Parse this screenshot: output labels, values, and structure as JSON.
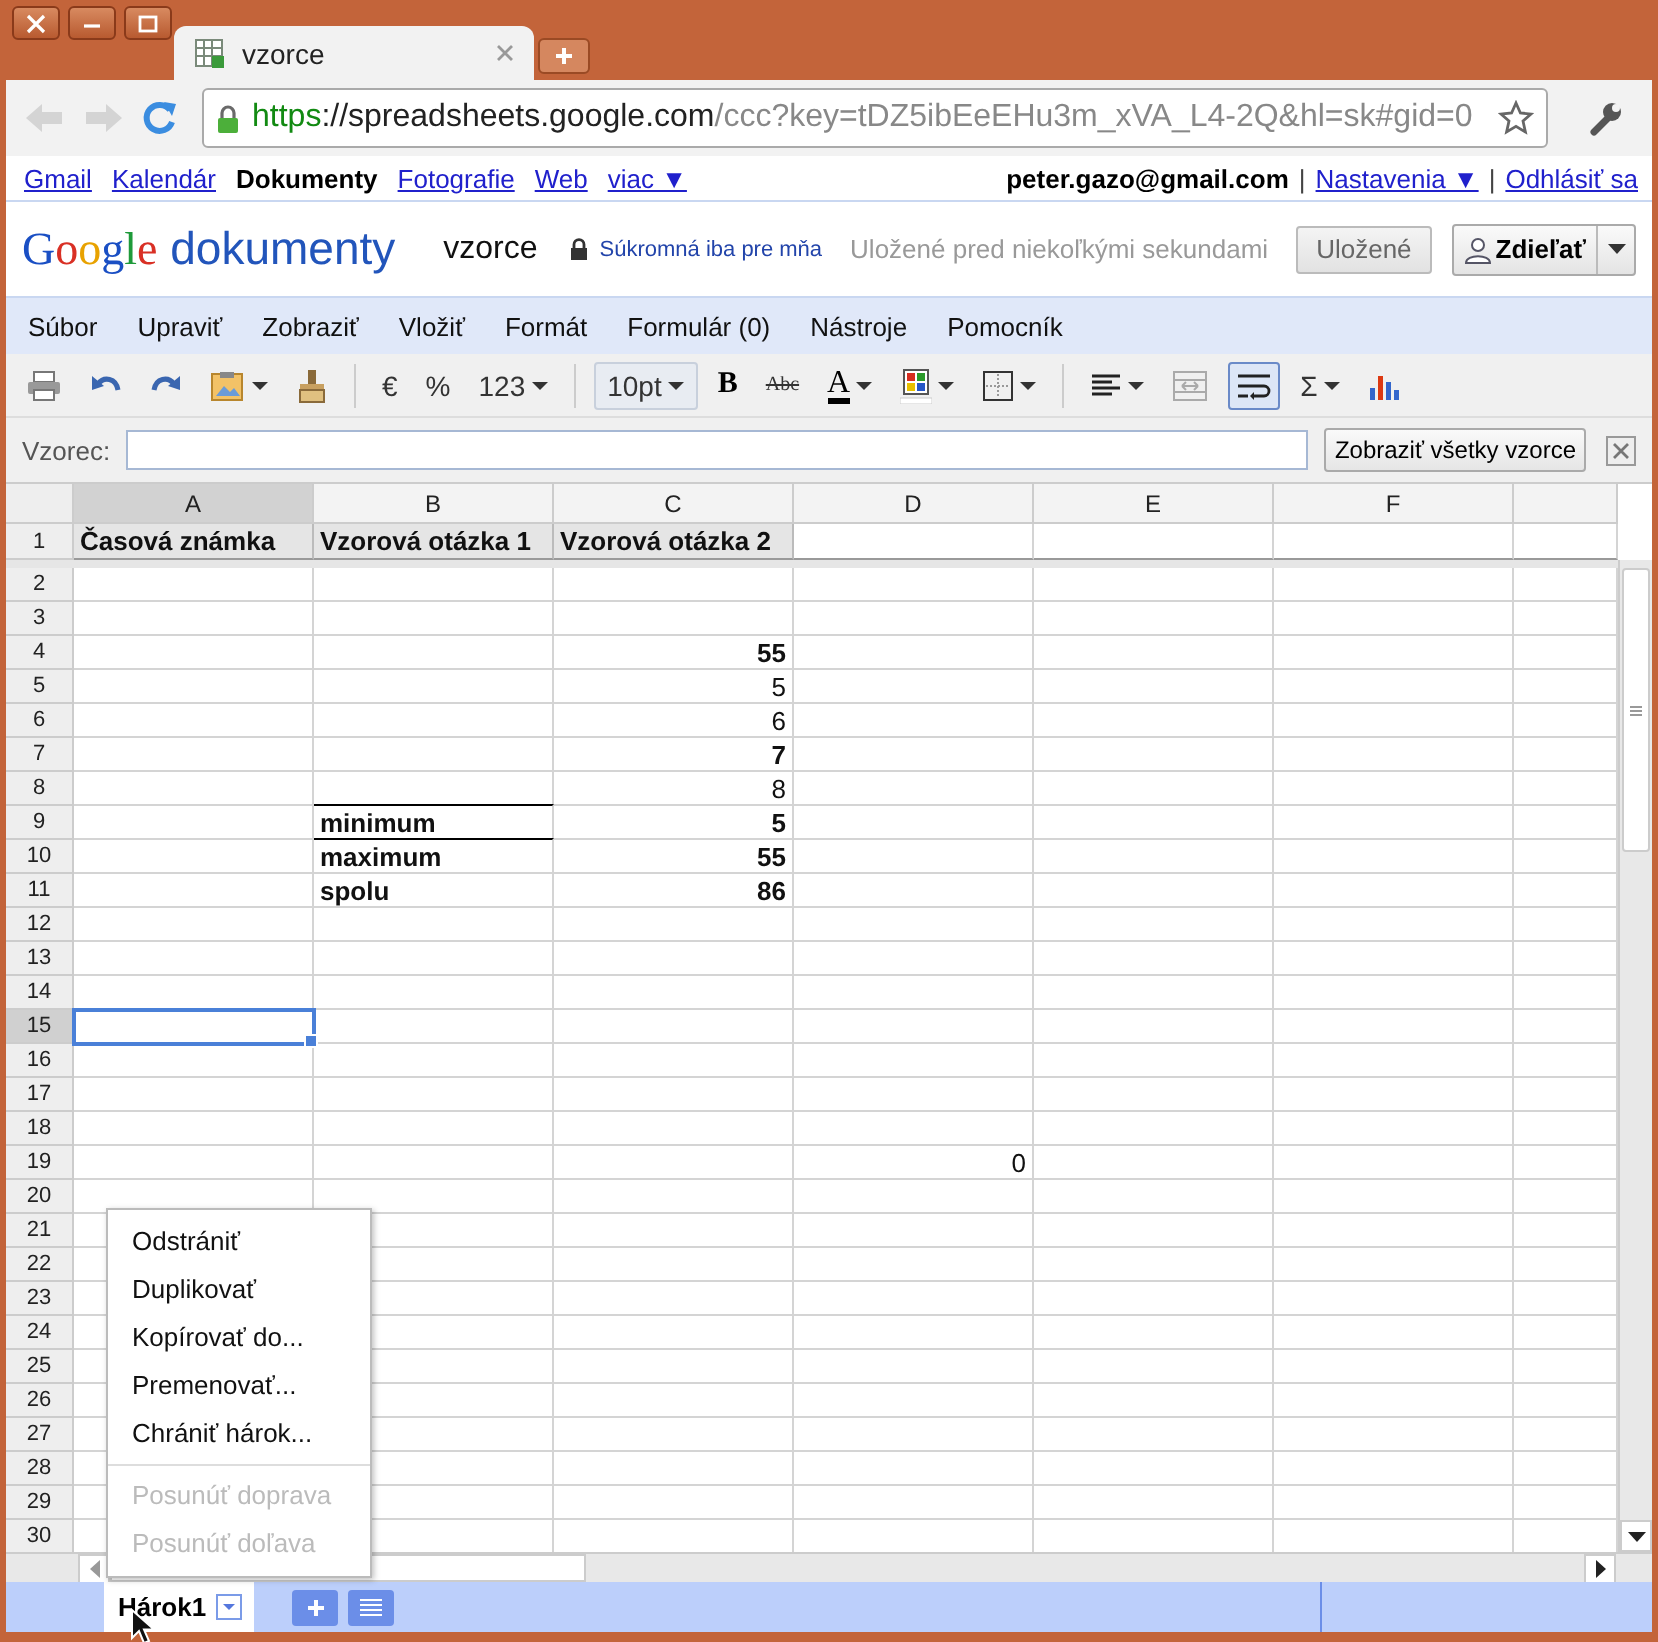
{
  "browser": {
    "tab": {
      "title": "vzorce"
    },
    "url": {
      "scheme": "https",
      "host": "://spreadsheets.google.com",
      "rest": "/ccc?key=tDZ5ibEeEHu3m_xVA_L4-2Q&hl=sk#gid=0"
    },
    "back_disabled": true,
    "forward_disabled": true
  },
  "google_bar": {
    "links": [
      {
        "label": "Gmail",
        "selected": false
      },
      {
        "label": "Kalendár",
        "selected": false
      },
      {
        "label": "Dokumenty",
        "selected": true
      },
      {
        "label": "Fotografie",
        "selected": false
      },
      {
        "label": "Web",
        "selected": false
      },
      {
        "label": "viac ▼",
        "selected": false
      }
    ],
    "user": "peter.gazo@gmail.com",
    "separator": "|",
    "settings": "Nastavenia ▼",
    "logout": "Odhlásiť sa"
  },
  "header": {
    "logo": "Google",
    "product": "dokumenty",
    "doc_title": "vzorce",
    "privacy": "Súkromná iba pre mňa",
    "save_status": "Uložené pred niekoľkými sekundami",
    "saved_button": "Uložené",
    "share_button": "Zdieľať"
  },
  "menu": [
    "Súbor",
    "Upraviť",
    "Zobraziť",
    "Vložiť",
    "Formát",
    "Formulár (0)",
    "Nástroje",
    "Pomocník"
  ],
  "toolbar": [
    {
      "kind": "print"
    },
    {
      "kind": "undo"
    },
    {
      "kind": "redo"
    },
    {
      "kind": "paste",
      "caret": true
    },
    {
      "kind": "paint"
    },
    {
      "kind": "separator"
    },
    {
      "kind": "text",
      "label": "€"
    },
    {
      "kind": "text",
      "label": "%"
    },
    {
      "kind": "text",
      "label": "123",
      "caret": true
    },
    {
      "kind": "separator"
    },
    {
      "kind": "size",
      "label": "10pt",
      "caret": true
    },
    {
      "kind": "bold",
      "label": "B"
    },
    {
      "kind": "strike",
      "label": "Abc"
    },
    {
      "kind": "textcolor",
      "label": "A",
      "caret": true
    },
    {
      "kind": "fillcolor",
      "caret": true
    },
    {
      "kind": "borders",
      "caret": true
    },
    {
      "kind": "separator"
    },
    {
      "kind": "align",
      "caret": true
    },
    {
      "kind": "merge"
    },
    {
      "kind": "wrap",
      "on": true
    },
    {
      "kind": "text",
      "label": "Σ",
      "caret": true
    },
    {
      "kind": "chart"
    }
  ],
  "formula_bar": {
    "label": "Vzorec:",
    "button": "Zobraziť všetky vzorce"
  },
  "columns": [
    {
      "label": "A",
      "selected": true
    },
    {
      "label": "B",
      "selected": false
    },
    {
      "label": "C",
      "selected": false
    },
    {
      "label": "D",
      "selected": false
    },
    {
      "label": "E",
      "selected": false
    },
    {
      "label": "F",
      "selected": false
    }
  ],
  "rows": [
    {
      "number": "1",
      "selected": false,
      "frozen": true,
      "cells": {
        "a": {
          "text": "Časová známka",
          "bold": true
        },
        "b": {
          "text": "Vzorová otázka 1",
          "bold": true
        },
        "c": {
          "text": "Vzorová otázka 2",
          "bold": true
        }
      }
    },
    {
      "number": "2",
      "selected": false
    },
    {
      "number": "3",
      "selected": false
    },
    {
      "number": "4",
      "selected": false,
      "cells": {
        "c": {
          "text": "55",
          "bold": true,
          "right_aligned": true
        }
      }
    },
    {
      "number": "5",
      "selected": false,
      "cells": {
        "c": {
          "text": "5",
          "bold": false,
          "right_aligned": true
        }
      }
    },
    {
      "number": "6",
      "selected": false,
      "cells": {
        "c": {
          "text": "6",
          "bold": false,
          "right_aligned": true
        }
      }
    },
    {
      "number": "7",
      "selected": false,
      "cells": {
        "c": {
          "text": "7",
          "bold": true,
          "right_aligned": true
        }
      }
    },
    {
      "number": "8",
      "selected": false,
      "cells": {
        "c": {
          "text": "8",
          "bold": false,
          "right_aligned": true
        }
      }
    },
    {
      "number": "9",
      "selected": false,
      "cells": {
        "b": {
          "text": "minimum",
          "bold": true,
          "border_top": true
        },
        "c": {
          "text": "5",
          "bold": true,
          "right_aligned": true
        }
      }
    },
    {
      "number": "10",
      "selected": false,
      "cells": {
        "b": {
          "text": "maximum",
          "bold": true,
          "border_top": true
        },
        "c": {
          "text": "55",
          "bold": true,
          "right_aligned": true
        }
      }
    },
    {
      "number": "11",
      "selected": false,
      "cells": {
        "b": {
          "text": "spolu",
          "bold": true
        },
        "c": {
          "text": "86",
          "bold": true,
          "right_aligned": true
        }
      }
    },
    {
      "number": "12",
      "selected": false
    },
    {
      "number": "13",
      "selected": false
    },
    {
      "number": "14",
      "selected": false
    },
    {
      "number": "15",
      "selected": true
    },
    {
      "number": "16",
      "selected": false
    },
    {
      "number": "17",
      "selected": false
    },
    {
      "number": "18",
      "selected": false
    },
    {
      "number": "19",
      "selected": false,
      "cells": {
        "d": {
          "text": "0",
          "bold": false,
          "right_aligned": true
        }
      }
    },
    {
      "number": "20",
      "selected": false
    },
    {
      "number": "21",
      "selected": false
    },
    {
      "number": "22",
      "selected": false
    },
    {
      "number": "23",
      "selected": false
    },
    {
      "number": "24",
      "selected": false
    },
    {
      "number": "25",
      "selected": false
    },
    {
      "number": "26",
      "selected": false
    },
    {
      "number": "27",
      "selected": false
    },
    {
      "number": "28",
      "selected": false
    },
    {
      "number": "29",
      "selected": false
    },
    {
      "number": "30",
      "selected": false
    }
  ],
  "sheet_menu": {
    "groups": [
      [
        {
          "label": "Odstrániť",
          "disabled": false
        },
        {
          "label": "Duplikovať",
          "disabled": false
        },
        {
          "label": "Kopírovať do...",
          "disabled": false
        },
        {
          "label": "Premenovať...",
          "disabled": false
        },
        {
          "label": "Chrániť hárok...",
          "disabled": false
        }
      ],
      [
        {
          "label": "Posunúť doprava",
          "disabled": true
        },
        {
          "label": "Posunúť doľava",
          "disabled": true
        }
      ]
    ]
  },
  "sheet_tabs": [
    {
      "label": "Hárok1",
      "selected": true
    }
  ]
}
